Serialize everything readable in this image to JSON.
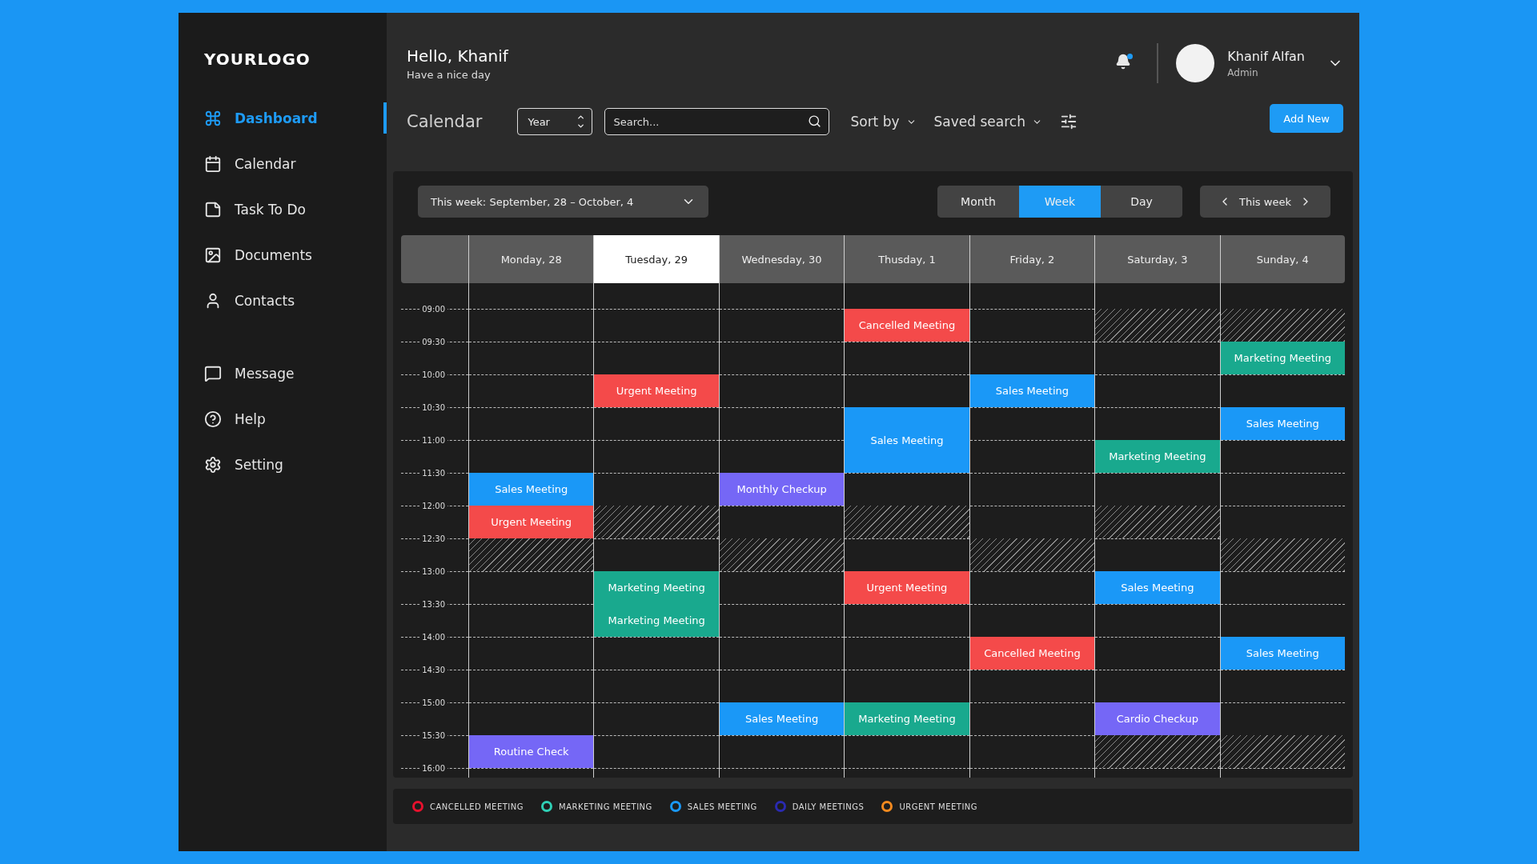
{
  "logo": "YOURLOGO",
  "sidebar": {
    "groups": [
      [
        {
          "label": "Dashboard",
          "selected": true
        },
        {
          "label": "Calendar",
          "selected": false
        },
        {
          "label": "Task To Do",
          "selected": false
        },
        {
          "label": "Documents",
          "selected": false
        },
        {
          "label": "Contacts",
          "selected": false
        }
      ],
      [
        {
          "label": "Message",
          "selected": false
        },
        {
          "label": "Help",
          "selected": false
        },
        {
          "label": "Setting",
          "selected": false
        }
      ]
    ]
  },
  "greeting": {
    "title": "Hello, Khanif",
    "subtitle": "Have a nice day"
  },
  "user": {
    "name": "Khanif Alfan",
    "role": "Admin",
    "has_notification": true
  },
  "toolbar": {
    "title": "Calendar",
    "period_select": "Year",
    "search": {
      "placeholder": "Search..."
    },
    "sort": "Sort by",
    "saved_search": "Saved search",
    "add_button": "Add New"
  },
  "calendar": {
    "range_label": "This week:",
    "range": "September, 28 – October, 4",
    "views": [
      {
        "label": "Month",
        "selected": false
      },
      {
        "label": "Week",
        "selected": true
      },
      {
        "label": "Day",
        "selected": false
      }
    ],
    "nav_label": "This week",
    "times": [
      "09:00",
      "09:30",
      "10:00",
      "10:30",
      "11:00",
      "11:30",
      "12:00",
      "12:30",
      "13:00",
      "13:30",
      "14:00",
      "14:30",
      "15:00",
      "15:30",
      "16:00"
    ],
    "days": [
      {
        "label": "Monday, 28",
        "selected": false,
        "slots": [
          {
            "kind": "free"
          },
          {
            "kind": "free"
          },
          {
            "kind": "free"
          },
          {
            "kind": "free"
          },
          {
            "kind": "free"
          },
          {
            "kind": "event",
            "title": "Sales Meeting",
            "color": "#1a98f7"
          },
          {
            "kind": "event",
            "title": "Urgent Meeting",
            "color": "#f44a4a"
          },
          {
            "kind": "blocked"
          },
          {
            "kind": "free"
          },
          {
            "kind": "free"
          },
          {
            "kind": "free"
          },
          {
            "kind": "free"
          },
          {
            "kind": "free"
          },
          {
            "kind": "event",
            "title": "Routine Check",
            "color": "#7567f6"
          }
        ]
      },
      {
        "label": "Tuesday, 29",
        "selected": true,
        "slots": [
          {
            "kind": "free"
          },
          {
            "kind": "free"
          },
          {
            "kind": "event",
            "title": "Urgent Meeting",
            "color": "#f44a4a"
          },
          {
            "kind": "free"
          },
          {
            "kind": "free"
          },
          {
            "kind": "free"
          },
          {
            "kind": "blocked"
          },
          {
            "kind": "free"
          },
          {
            "kind": "event",
            "title": "Marketing Meeting",
            "color": "#19a98e"
          },
          {
            "kind": "event",
            "title": "Marketing Meeting",
            "color": "#19a98e"
          },
          {
            "kind": "free"
          },
          {
            "kind": "free"
          },
          {
            "kind": "free"
          },
          {
            "kind": "free"
          }
        ]
      },
      {
        "label": "Wednesday, 30",
        "selected": false,
        "slots": [
          {
            "kind": "free"
          },
          {
            "kind": "free"
          },
          {
            "kind": "free"
          },
          {
            "kind": "free"
          },
          {
            "kind": "free"
          },
          {
            "kind": "event",
            "title": "Monthly Checkup",
            "color": "#7567f6"
          },
          {
            "kind": "free"
          },
          {
            "kind": "blocked"
          },
          {
            "kind": "free"
          },
          {
            "kind": "free"
          },
          {
            "kind": "free"
          },
          {
            "kind": "free"
          },
          {
            "kind": "event",
            "title": "Sales Meeting",
            "color": "#1a98f7"
          },
          {
            "kind": "free"
          }
        ]
      },
      {
        "label": "Thusday, 1",
        "selected": false,
        "slots": [
          {
            "kind": "event",
            "title": "Cancelled Meeting",
            "color": "#f44a4a"
          },
          {
            "kind": "free"
          },
          {
            "kind": "free"
          },
          {
            "kind": "event",
            "title": "Sales Meeting",
            "color": "#1a98f7"
          },
          {
            "kind": "continued"
          },
          {
            "kind": "free"
          },
          {
            "kind": "blocked"
          },
          {
            "kind": "free"
          },
          {
            "kind": "event",
            "title": "Urgent Meeting",
            "color": "#f44a4a"
          },
          {
            "kind": "free"
          },
          {
            "kind": "free"
          },
          {
            "kind": "free"
          },
          {
            "kind": "event",
            "title": "Marketing Meeting",
            "color": "#19a98e"
          },
          {
            "kind": "free"
          }
        ]
      },
      {
        "label": "Friday, 2",
        "selected": false,
        "slots": [
          {
            "kind": "free"
          },
          {
            "kind": "free"
          },
          {
            "kind": "event",
            "title": "Sales Meeting",
            "color": "#1a98f7"
          },
          {
            "kind": "free"
          },
          {
            "kind": "free"
          },
          {
            "kind": "free"
          },
          {
            "kind": "free"
          },
          {
            "kind": "blocked"
          },
          {
            "kind": "free"
          },
          {
            "kind": "free"
          },
          {
            "kind": "event",
            "title": "Cancelled Meeting",
            "color": "#f44a4a"
          },
          {
            "kind": "free"
          },
          {
            "kind": "free"
          },
          {
            "kind": "free"
          }
        ]
      },
      {
        "label": "Saturday, 3",
        "selected": false,
        "slots": [
          {
            "kind": "blocked"
          },
          {
            "kind": "free"
          },
          {
            "kind": "free"
          },
          {
            "kind": "free"
          },
          {
            "kind": "event",
            "title": "Marketing Meeting",
            "color": "#19a98e"
          },
          {
            "kind": "free"
          },
          {
            "kind": "blocked"
          },
          {
            "kind": "free"
          },
          {
            "kind": "event",
            "title": "Sales Meeting",
            "color": "#1a98f7"
          },
          {
            "kind": "free"
          },
          {
            "kind": "free"
          },
          {
            "kind": "free"
          },
          {
            "kind": "event",
            "title": "Cardio Checkup",
            "color": "#7567f6"
          },
          {
            "kind": "blocked"
          }
        ]
      },
      {
        "label": "Sunday, 4",
        "selected": false,
        "slots": [
          {
            "kind": "blocked"
          },
          {
            "kind": "event",
            "title": "Marketing Meeting",
            "color": "#19a98e"
          },
          {
            "kind": "free"
          },
          {
            "kind": "event",
            "title": "Sales Meeting",
            "color": "#1a98f7"
          },
          {
            "kind": "free"
          },
          {
            "kind": "free"
          },
          {
            "kind": "free"
          },
          {
            "kind": "blocked"
          },
          {
            "kind": "free"
          },
          {
            "kind": "free"
          },
          {
            "kind": "event",
            "title": "Sales Meeting",
            "color": "#1a98f7"
          },
          {
            "kind": "free"
          },
          {
            "kind": "free"
          },
          {
            "kind": "blocked"
          }
        ]
      }
    ]
  },
  "legend": [
    {
      "label": "CANCELLED MEETING",
      "color": "#e8112d"
    },
    {
      "label": "MARKETING MEETING",
      "color": "#2fd0b5"
    },
    {
      "label": "SALES MEETING",
      "color": "#1a98f7"
    },
    {
      "label": "DAILY MEETINGS",
      "color": "#2a2ab0"
    },
    {
      "label": "URGENT MEETING",
      "color": "#f58a1f"
    }
  ]
}
